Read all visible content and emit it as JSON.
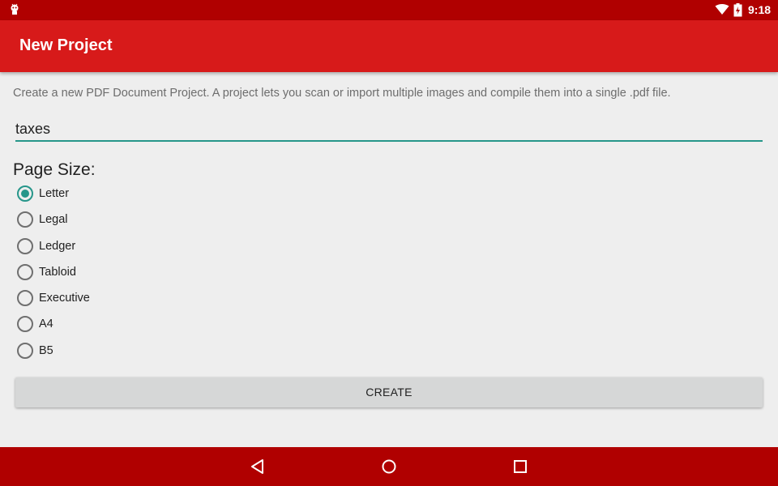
{
  "status_bar": {
    "time": "9:18",
    "icons": [
      "android-debug-icon",
      "wifi-icon",
      "battery-icon"
    ]
  },
  "app_bar": {
    "title": "New Project"
  },
  "form": {
    "description": "Create a new PDF Document Project.  A project lets you scan or import multiple images and compile them into a single .pdf file.",
    "project_name_value": "taxes",
    "page_size_label": "Page Size:",
    "page_sizes": [
      {
        "label": "Letter",
        "checked": true
      },
      {
        "label": "Legal",
        "checked": false
      },
      {
        "label": "Ledger",
        "checked": false
      },
      {
        "label": "Tabloid",
        "checked": false
      },
      {
        "label": "Executive",
        "checked": false
      },
      {
        "label": "A4",
        "checked": false
      },
      {
        "label": "B5",
        "checked": false
      }
    ],
    "create_label": "CREATE"
  },
  "nav_bar": {
    "icons": [
      "back-icon",
      "home-icon",
      "recents-icon"
    ]
  },
  "colors": {
    "status_bar": "#b00000",
    "app_bar": "#d71a1a",
    "accent": "#26968a",
    "background": "#eeeeee",
    "button": "#d6d7d7"
  }
}
